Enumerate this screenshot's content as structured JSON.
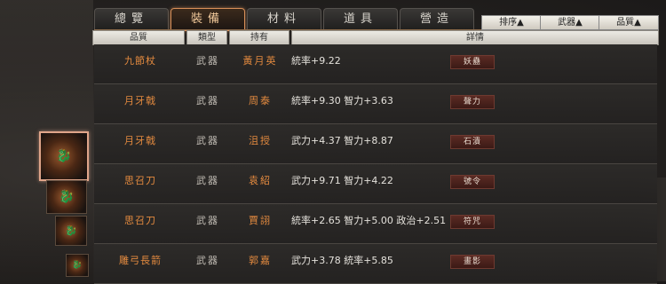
{
  "tabs": [
    {
      "label": "總覽",
      "active": false
    },
    {
      "label": "裝備",
      "active": true
    },
    {
      "label": "材料",
      "active": false
    },
    {
      "label": "道具",
      "active": false
    },
    {
      "label": "營造",
      "active": false
    }
  ],
  "sort_buttons": [
    {
      "label": "排序▲"
    },
    {
      "label": "武器▲"
    },
    {
      "label": "品質▲"
    }
  ],
  "headers": {
    "quality": "品質",
    "type": "類型",
    "owner": "持有",
    "detail": "詳情"
  },
  "items": [
    {
      "name": "九節杖",
      "type": "武器",
      "owner": "黃月英",
      "detail": "統率+9.22",
      "tag": "妖蠱"
    },
    {
      "name": "月牙戟",
      "type": "武器",
      "owner": "周泰",
      "detail": "統率+9.30  智力+3.63",
      "tag": "聲力"
    },
    {
      "name": "月牙戟",
      "type": "武器",
      "owner": "沮授",
      "detail": "武力+4.37  智力+8.87",
      "tag": "石潰"
    },
    {
      "name": "思召刀",
      "type": "武器",
      "owner": "袁紹",
      "detail": "武力+9.71  智力+4.22",
      "tag": "號令"
    },
    {
      "name": "思召刀",
      "type": "武器",
      "owner": "賈詡",
      "detail": "統率+2.65  智力+5.00  政治+2.51",
      "tag": "符咒"
    },
    {
      "name": "雕弓長箭",
      "type": "武器",
      "owner": "郭嘉",
      "detail": "武力+3.78  統率+5.85",
      "tag": "畫影"
    }
  ],
  "thumbnails": [
    {
      "icon": "dragon-icon",
      "selected": true
    },
    {
      "icon": "dragon-icon",
      "selected": false
    },
    {
      "icon": "dragon-icon",
      "selected": false
    },
    {
      "icon": "dragon-icon",
      "selected": false
    }
  ]
}
